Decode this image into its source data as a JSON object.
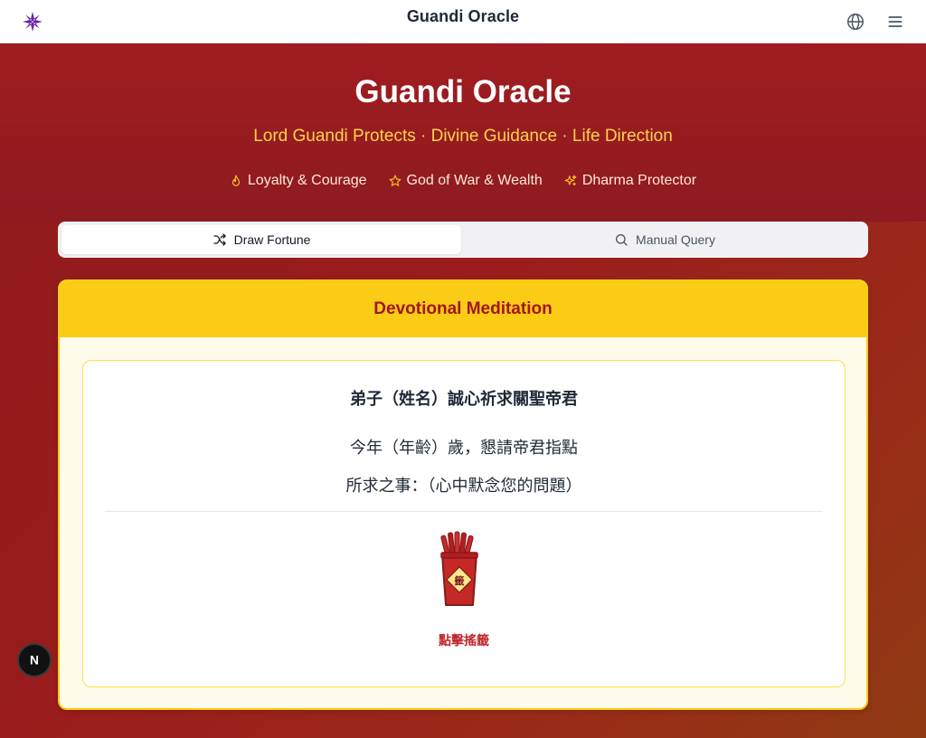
{
  "app": {
    "title": "Guandi Oracle"
  },
  "hero": {
    "title": "Guandi Oracle",
    "subtitle": "Lord Guandi Protects · Divine Guidance · Life Direction",
    "badges": [
      {
        "label": "Loyalty & Courage",
        "icon": "flame-icon"
      },
      {
        "label": "God of War & Wealth",
        "icon": "star-icon"
      },
      {
        "label": "Dharma Protector",
        "icon": "sparkles-icon"
      }
    ]
  },
  "tabs": [
    {
      "label": "Draw Fortune",
      "icon": "shuffle-icon",
      "active": true
    },
    {
      "label": "Manual Query",
      "icon": "search-icon",
      "active": false
    }
  ],
  "card": {
    "header": "Devotional Meditation",
    "line1": "弟子（姓名）誠心祈求關聖帝君",
    "line2": "今年（年齡）歲，懇請帝君指點",
    "line3": "所求之事：（心中默念您的問題）",
    "shaker_label": "籤",
    "shake_label": "點擊搖籤"
  },
  "floating": {
    "n_label": "N"
  },
  "colors": {
    "primary_red": "#a3161c",
    "gold": "#facc15",
    "subtitle_gold": "#fcd34d",
    "logo_purple": "#6b21a8"
  }
}
